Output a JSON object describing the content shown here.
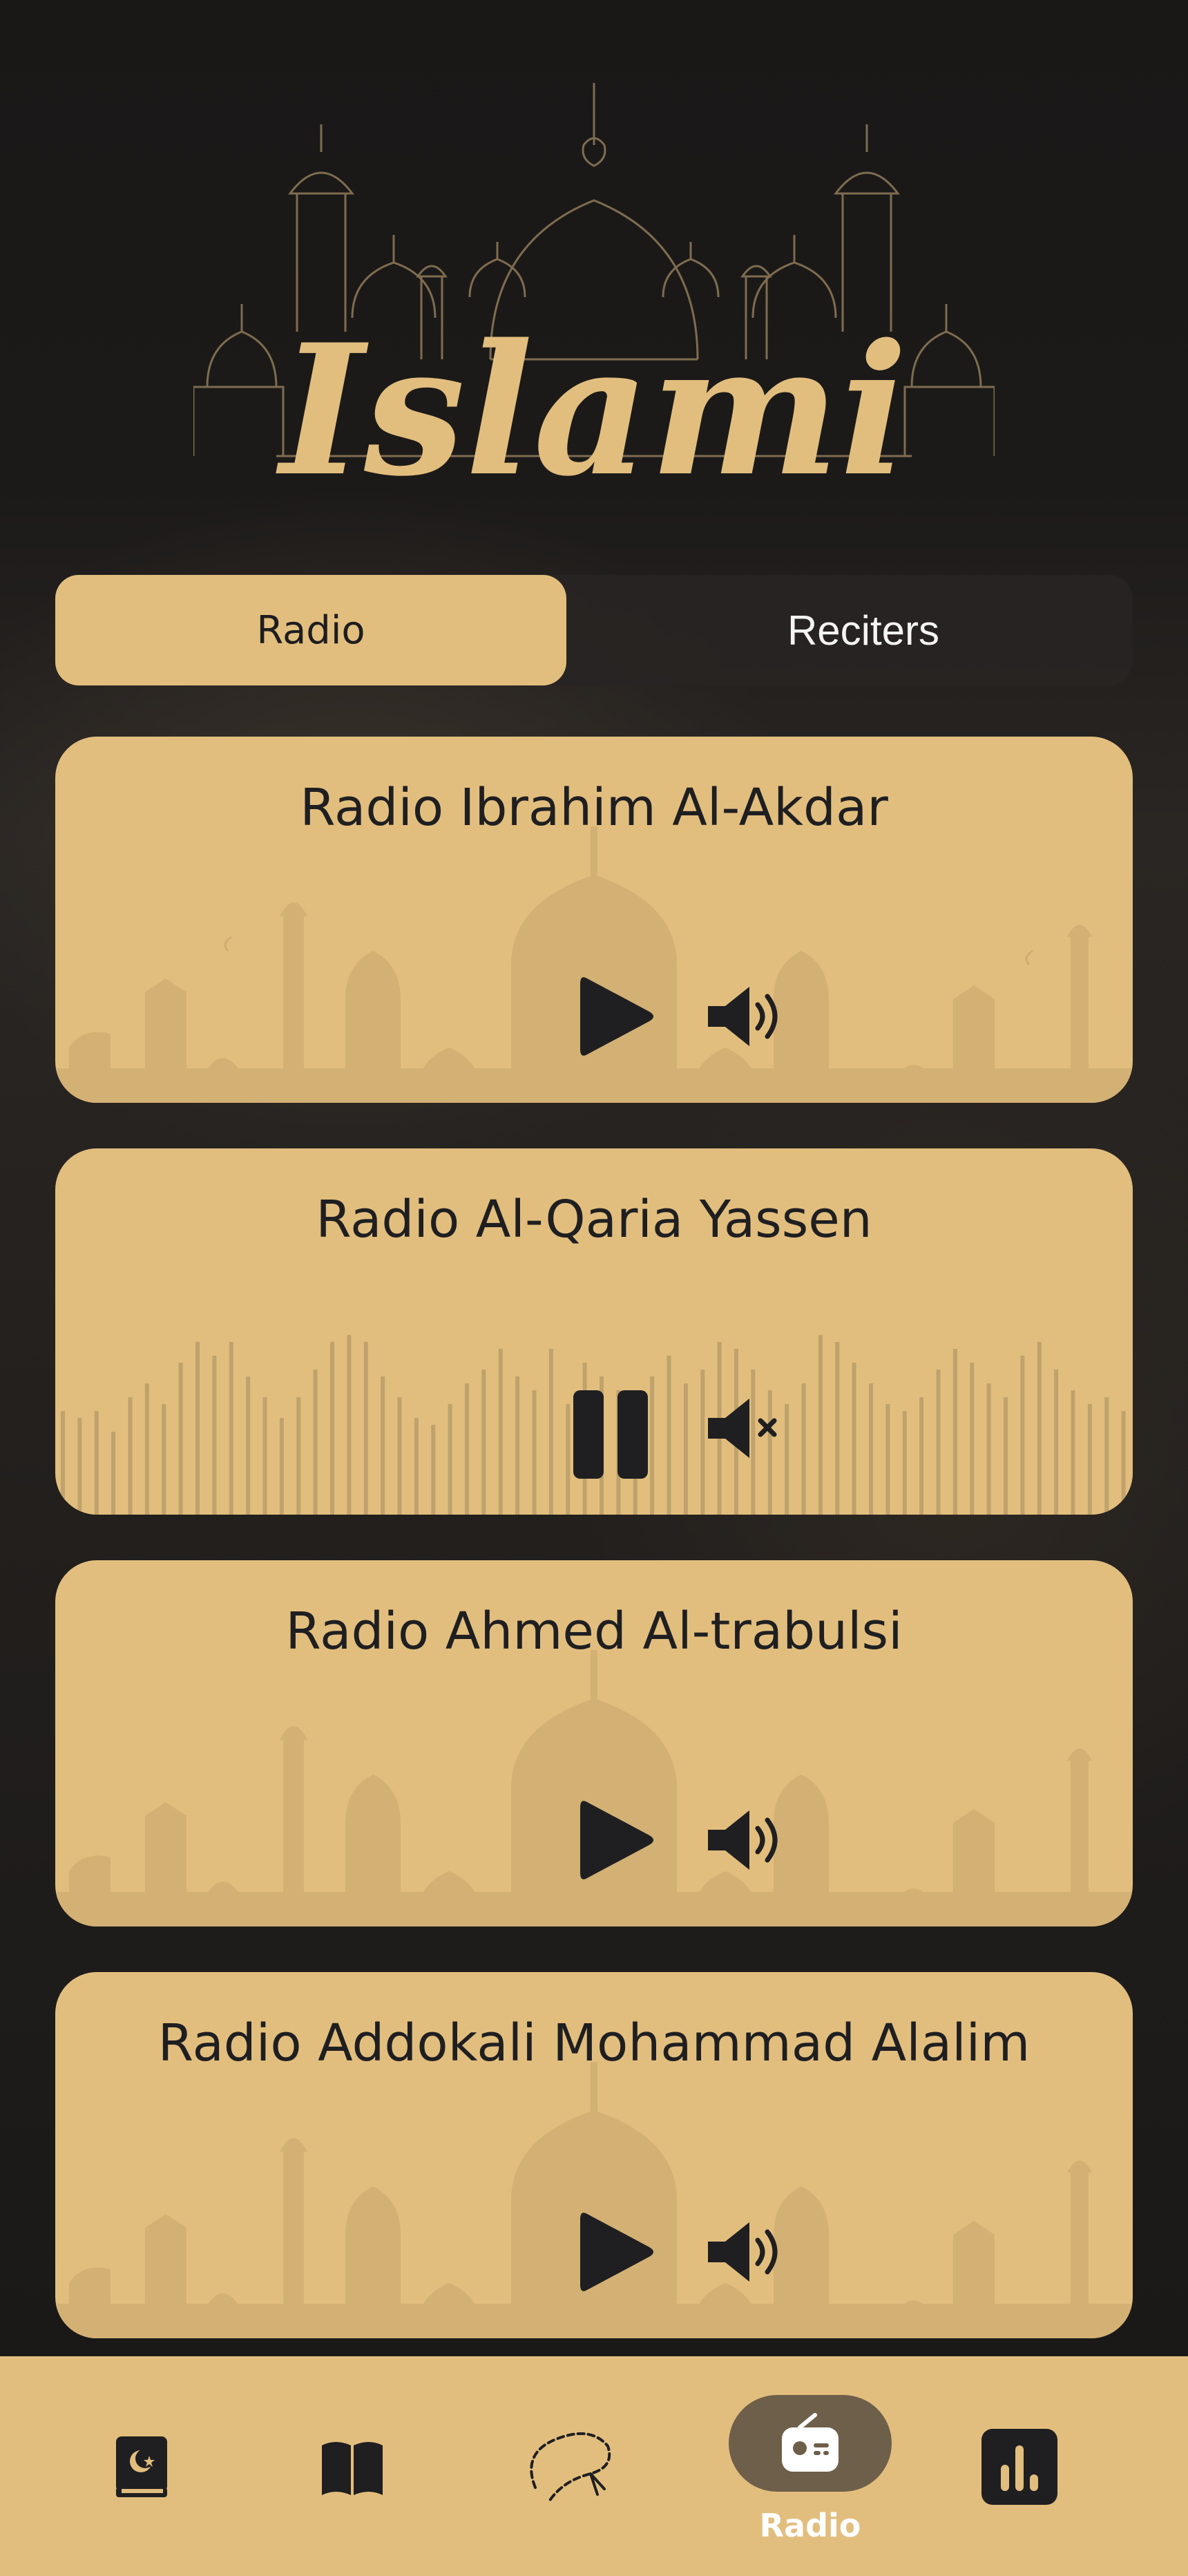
{
  "app": {
    "logo_text": "Islami"
  },
  "tabs": [
    {
      "label": "Radio",
      "active": true
    },
    {
      "label": "Reciters",
      "active": false
    }
  ],
  "radios": [
    {
      "title": "Radio Ibrahim Al-Akdar",
      "state": "paused",
      "muted": false
    },
    {
      "title": "Radio Al-Qaria Yassen",
      "state": "playing",
      "muted": true
    },
    {
      "title": "Radio Ahmed Al-trabulsi",
      "state": "paused",
      "muted": false
    },
    {
      "title": "Radio Addokali Mohammad Alalim",
      "state": "paused",
      "muted": false
    }
  ],
  "bottom_nav": {
    "items": [
      {
        "name": "quran-icon"
      },
      {
        "name": "hadith-book-icon"
      },
      {
        "name": "sebha-icon"
      },
      {
        "name": "radio-icon",
        "label": "Radio",
        "active": true
      },
      {
        "name": "time-chart-icon"
      }
    ]
  },
  "colors": {
    "gold": "#e2be7e",
    "dark": "#1f1f21",
    "active_pill": "#6e5f4a"
  }
}
